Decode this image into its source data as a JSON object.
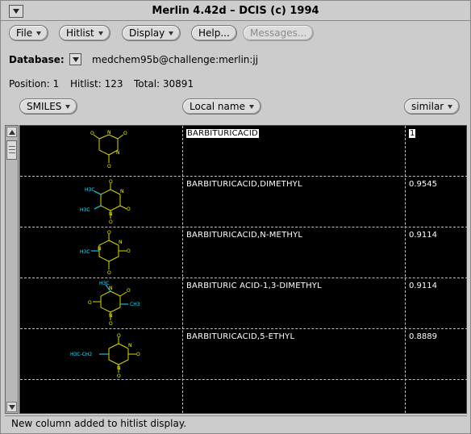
{
  "window": {
    "title": "Merlin 4.42d – DCIS (c) 1994"
  },
  "menubar": {
    "file": "File",
    "hitlist": "Hitlist",
    "display": "Display",
    "help": "Help...",
    "messages": "Messages..."
  },
  "database": {
    "label": "Database:",
    "value": "medchem95b@challenge:merlin:jj"
  },
  "position": {
    "label": "Position:",
    "value": "1"
  },
  "hitlist": {
    "label": "Hitlist:",
    "value": "123"
  },
  "total": {
    "label": "Total:",
    "value": "30891"
  },
  "columns": {
    "smiles": "SMILES",
    "local_name": "Local name",
    "similar": "similar"
  },
  "rows": [
    {
      "name": "BARBITURICACID",
      "similar": "1",
      "atoms": [
        {
          "l": "N",
          "c": "yellow"
        },
        {
          "l": "O",
          "c": "yellow"
        },
        {
          "l": "N",
          "c": "yellow"
        },
        {
          "l": "O",
          "c": "yellow"
        },
        {
          "l": "O",
          "c": "yellow"
        }
      ]
    },
    {
      "name": "BARBITURICACID,DIMETHYL",
      "similar": "0.9545",
      "atoms": [
        {
          "l": "O",
          "c": "yellow"
        },
        {
          "l": "N",
          "c": "yellow"
        },
        {
          "l": "O",
          "c": "yellow"
        },
        {
          "l": "N",
          "c": "yellow"
        },
        {
          "l": "O",
          "c": "yellow"
        },
        {
          "l": "H3C",
          "c": "cyan"
        },
        {
          "l": "H3C",
          "c": "cyan"
        }
      ]
    },
    {
      "name": "BARBITURICACID,N-METHYL",
      "similar": "0.9114",
      "atoms": [
        {
          "l": "O",
          "c": "yellow"
        },
        {
          "l": "N",
          "c": "yellow"
        },
        {
          "l": "O",
          "c": "yellow"
        },
        {
          "l": "N",
          "c": "yellow"
        },
        {
          "l": "O",
          "c": "yellow"
        },
        {
          "l": "H3C",
          "c": "cyan"
        }
      ]
    },
    {
      "name": "BARBITURIC ACID-1,3-DIMETHYL",
      "similar": "0.9114",
      "atoms": [
        {
          "l": "H3C",
          "c": "cyan"
        },
        {
          "l": "O",
          "c": "yellow"
        },
        {
          "l": "N",
          "c": "yellow"
        },
        {
          "l": "O",
          "c": "yellow"
        },
        {
          "l": "N",
          "c": "yellow"
        },
        {
          "l": "CH3",
          "c": "cyan"
        },
        {
          "l": "O",
          "c": "yellow"
        }
      ]
    },
    {
      "name": "BARBITURICACID,5-ETHYL",
      "similar": "0.8889",
      "atoms": [
        {
          "l": "O",
          "c": "yellow"
        },
        {
          "l": "N",
          "c": "yellow"
        },
        {
          "l": "O",
          "c": "yellow"
        },
        {
          "l": "N",
          "c": "yellow"
        },
        {
          "l": "O",
          "c": "yellow"
        },
        {
          "l": "H3C-CH2",
          "c": "cyan"
        }
      ]
    }
  ],
  "status": {
    "message": "New column added to hitlist display."
  },
  "colors": {
    "bond": "#d8d800",
    "heteroatom": "#f2f200",
    "methyl": "#20e0ff",
    "grid_bg": "#000000"
  },
  "icons": {
    "window_menu": "triangle-down-icon",
    "dropdown": "triangle-down-icon",
    "scroll_up": "triangle-up-icon",
    "scroll_down": "triangle-down-icon"
  }
}
